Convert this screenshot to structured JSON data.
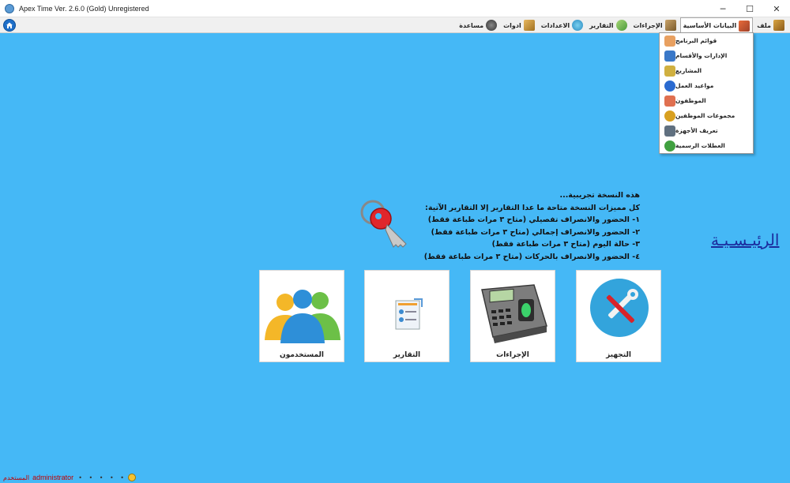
{
  "window": {
    "title": "Apex Time Ver. 2.6.0 (Gold) Unregistered",
    "controls": {
      "minimize": "─",
      "maximize": "☐",
      "close": "✕"
    }
  },
  "menubar": {
    "items": [
      {
        "label": "ملف",
        "icon": "file-icon"
      },
      {
        "label": "البيانات الأساسية",
        "icon": "basic-data-icon",
        "active": true
      },
      {
        "label": "الإجراءات",
        "icon": "procedures-icon"
      },
      {
        "label": "التقارير",
        "icon": "reports-icon"
      },
      {
        "label": "الاعدادات",
        "icon": "settings-icon"
      },
      {
        "label": "ادوات",
        "icon": "tools-icon"
      },
      {
        "label": "مساعدة",
        "icon": "help-icon"
      }
    ]
  },
  "dropdown": {
    "items": [
      {
        "label": "قوائم البرنامج",
        "icon": "program-lists-icon",
        "color": "#e8a060"
      },
      {
        "label": "الإدارات والأقسام",
        "icon": "departments-icon",
        "color": "#3a78c8"
      },
      {
        "label": "المشاريع",
        "icon": "projects-icon",
        "color": "#d0b040"
      },
      {
        "label": "مواعيد العمل",
        "icon": "work-schedule-icon",
        "color": "#2a6ad0"
      },
      {
        "label": "الموظفون",
        "icon": "employees-icon",
        "color": "#e07050"
      },
      {
        "label": "مجموعات الموظفين",
        "icon": "employee-groups-icon",
        "color": "#d8a020"
      },
      {
        "label": "تعريف الأجهزة",
        "icon": "devices-icon",
        "color": "#607080"
      },
      {
        "label": "العطلات الرسمية",
        "icon": "holidays-icon",
        "color": "#40a040"
      }
    ]
  },
  "trial_notice": {
    "lines": [
      "هذه النسخة تجريبية...",
      "كل مميزات النسخة متاحة ما عدا التقارير إلا التقارير الآتية:",
      "١- الحضور والانصراف تفصيلي (متاح ٣ مرات طباعة فقط)",
      "٢- الحضور والانصراف إجمالي (متاح ٣ مرات طباعة فقط)",
      "٣- حالة اليوم (متاح ٣ مرات طباعة فقط)",
      "٤- الحضور والانصراف بالحركات (متاح ٣ مرات طباعة فقط)"
    ]
  },
  "home_link": "الرئيـسـيـة",
  "tiles": [
    {
      "label": "التجهيز",
      "icon": "setup-tools-icon"
    },
    {
      "label": "الإجراءات",
      "icon": "time-clock-device-icon"
    },
    {
      "label": "التقارير",
      "icon": "reports-document-icon"
    },
    {
      "label": "المستخدمون",
      "icon": "users-group-icon"
    }
  ],
  "statusbar": {
    "label": "المستخدم",
    "user": "administrator",
    "dots": "• • • • •"
  },
  "colors": {
    "background": "#45b8f6",
    "link": "#1b2c9e",
    "status_text": "#c00000"
  }
}
